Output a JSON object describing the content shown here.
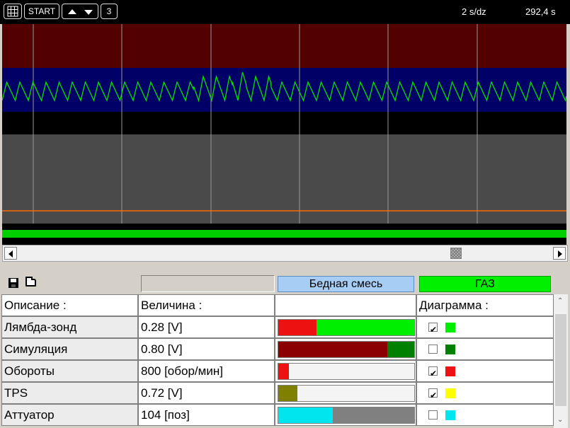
{
  "toolbar": {
    "start_label": "START",
    "channel_number": "3",
    "scale": "2 s/dz",
    "time": "292,4 s",
    "icons": [
      "grid-icon",
      "arrow-up-icon",
      "arrow-down-icon"
    ]
  },
  "chart": {
    "colors": {
      "band_top": "#520000",
      "band_mid": "#000066",
      "band_lower": "#4a4a4a",
      "background": "#000000",
      "gridline": "#9a9a9a",
      "trace": "#00e000",
      "orange_line": "#ff6a00",
      "green_strip": "#00d000"
    }
  },
  "panel": {
    "mixture_label": "Бедная смесь",
    "fuel_label": "ГАЗ",
    "icons": [
      "floppy-disk-icon",
      "folder-open-icon"
    ],
    "headers": {
      "description": "Описание :",
      "value": "Величина :",
      "diagram": "Диаграмма :"
    },
    "rows": [
      {
        "name": "Лямбда-зонд",
        "value": "0.28 [V]",
        "bar_fraction": 0.28,
        "bar_fill": "#ee1111",
        "bar_rest": "#00ee00",
        "checked": true,
        "color": "#00ee00"
      },
      {
        "name": "Симуляция",
        "value": "0.80 [V]",
        "bar_fraction": 0.8,
        "bar_fill": "#8b0000",
        "bar_rest": "#008000",
        "checked": false,
        "color": "#008000"
      },
      {
        "name": "Обороты",
        "value": "800 [обор/мин]",
        "bar_fraction": 0.08,
        "bar_fill": "#ee1111",
        "bar_rest": "#f4f4f4",
        "checked": true,
        "color": "#ee1111"
      },
      {
        "name": "TPS",
        "value": "0.72 [V]",
        "bar_fraction": 0.14,
        "bar_fill": "#808000",
        "bar_rest": "#f4f4f4",
        "checked": true,
        "color": "#ffff00"
      },
      {
        "name": "Аттуатор",
        "value": "104 [поз]",
        "bar_fraction": 0.4,
        "bar_fill": "#00e5ee",
        "bar_rest": "#808080",
        "checked": false,
        "color": "#00e5ee"
      }
    ]
  }
}
